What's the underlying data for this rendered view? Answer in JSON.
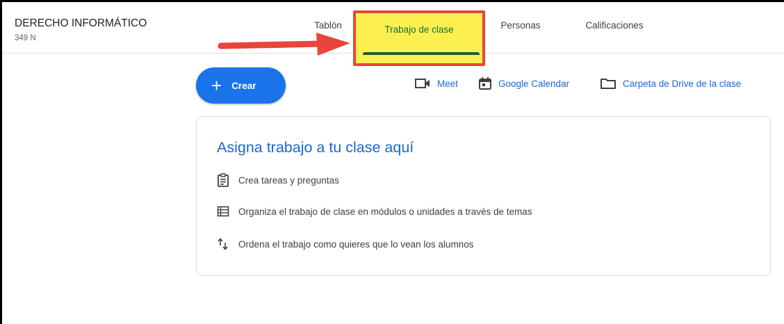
{
  "course": {
    "title": "DERECHO INFORMÁTICO",
    "subtitle": "349 N"
  },
  "tabs": [
    {
      "label": "Tablón"
    },
    {
      "label": "Trabajo de clase",
      "active": true
    },
    {
      "label": "Personas"
    },
    {
      "label": "Calificaciones"
    }
  ],
  "toolbar": {
    "create_label": "Crear",
    "meet_label": "Meet",
    "calendar_label": "Google Calendar",
    "drive_label": "Carpeta de Drive de la clase"
  },
  "empty_state": {
    "title": "Asigna trabajo a tu clase aquí",
    "items": [
      {
        "icon": "assignment-icon",
        "text": "Crea tareas y preguntas"
      },
      {
        "icon": "topics-list-icon",
        "text": "Organiza el trabajo de clase en módulos o unidades a través de temas"
      },
      {
        "icon": "reorder-arrows-icon",
        "text": "Ordena el trabajo como quieres que lo vean los alumnos"
      }
    ]
  },
  "colors": {
    "accent_blue": "#1a73e8",
    "link_blue": "#1967d2",
    "highlight_yellow": "#fbf04f",
    "annotation_red": "#e8453c",
    "active_tab_green": "#1e5c3a"
  }
}
